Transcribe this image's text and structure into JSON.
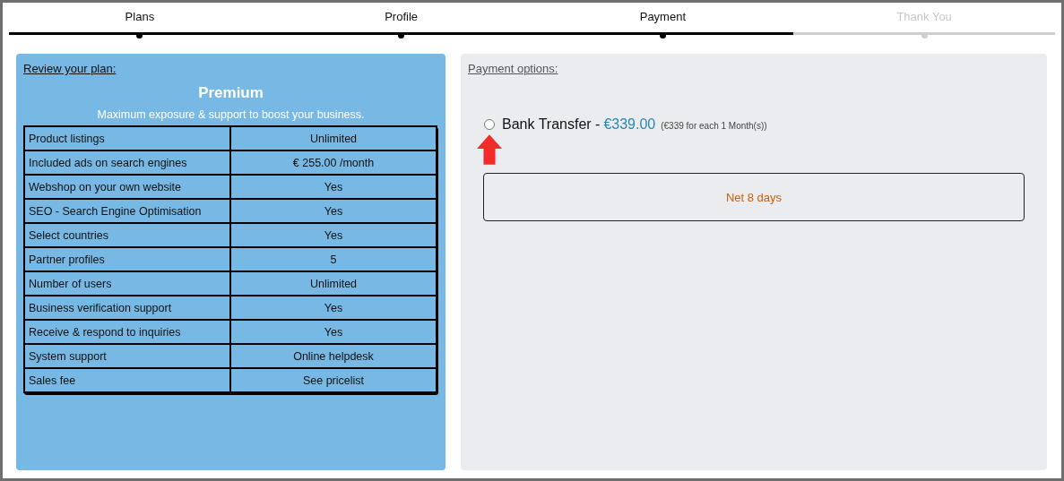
{
  "steps": [
    {
      "label": "Plans",
      "done": true
    },
    {
      "label": "Profile",
      "done": true
    },
    {
      "label": "Payment",
      "done": true
    },
    {
      "label": "Thank You",
      "done": false
    }
  ],
  "plan_panel": {
    "heading": "Review your plan:",
    "plan_name": "Premium",
    "tagline": "Maximum exposure & support to boost your business.",
    "features": [
      {
        "name": "Product listings",
        "value": "Unlimited"
      },
      {
        "name": "Included ads on search engines",
        "value": "€ 255.00 /month"
      },
      {
        "name": "Webshop on your own website",
        "value": "Yes"
      },
      {
        "name": "SEO - Search Engine Optimisation",
        "value": "Yes"
      },
      {
        "name": "Select countries",
        "value": "Yes"
      },
      {
        "name": "Partner profiles",
        "value": "5"
      },
      {
        "name": "Number of users",
        "value": "Unlimited"
      },
      {
        "name": "Business verification support",
        "value": "Yes"
      },
      {
        "name": "Receive & respond to inquiries",
        "value": "Yes"
      },
      {
        "name": "System support",
        "value": "Online helpdesk"
      },
      {
        "name": "Sales fee",
        "value": "See pricelist"
      }
    ]
  },
  "payment_panel": {
    "heading": "Payment options:",
    "options": [
      {
        "label": "Bank Transfer -",
        "price": "€339.00",
        "note": "(€339 for each 1 Month(s))",
        "selected": false
      }
    ],
    "terms": "Net 8 days"
  }
}
